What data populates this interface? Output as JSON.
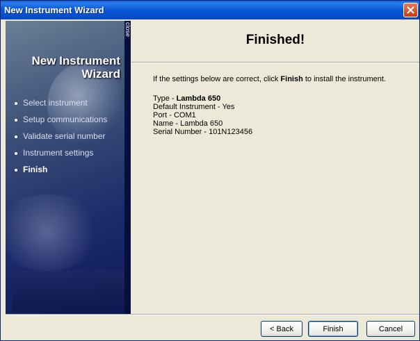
{
  "window": {
    "title": "New Instrument Wizard"
  },
  "sidebar": {
    "close_label": "close",
    "title_line1": "New Instrument",
    "title_line2": "Wizard",
    "steps": [
      {
        "label": "Select instrument",
        "active": false
      },
      {
        "label": "Setup communications",
        "active": false
      },
      {
        "label": "Validate serial number",
        "active": false
      },
      {
        "label": "Instrument settings",
        "active": false
      },
      {
        "label": "Finish",
        "active": true
      }
    ]
  },
  "content": {
    "heading": "Finished!",
    "instruction_pre": "If the settings below are correct, click ",
    "instruction_bold": "Finish",
    "instruction_post": " to install the instrument.",
    "details": {
      "type_label": "Type - ",
      "type_value": "Lambda 650",
      "default_instrument": "Default Instrument - Yes",
      "port": "Port - COM1",
      "name": "Name - Lambda 650",
      "serial_number": "Serial Number - 101N123456"
    }
  },
  "buttons": {
    "back": "< Back",
    "finish": "Finish",
    "cancel": "Cancel"
  },
  "icons": {
    "close": "close-x-icon"
  }
}
